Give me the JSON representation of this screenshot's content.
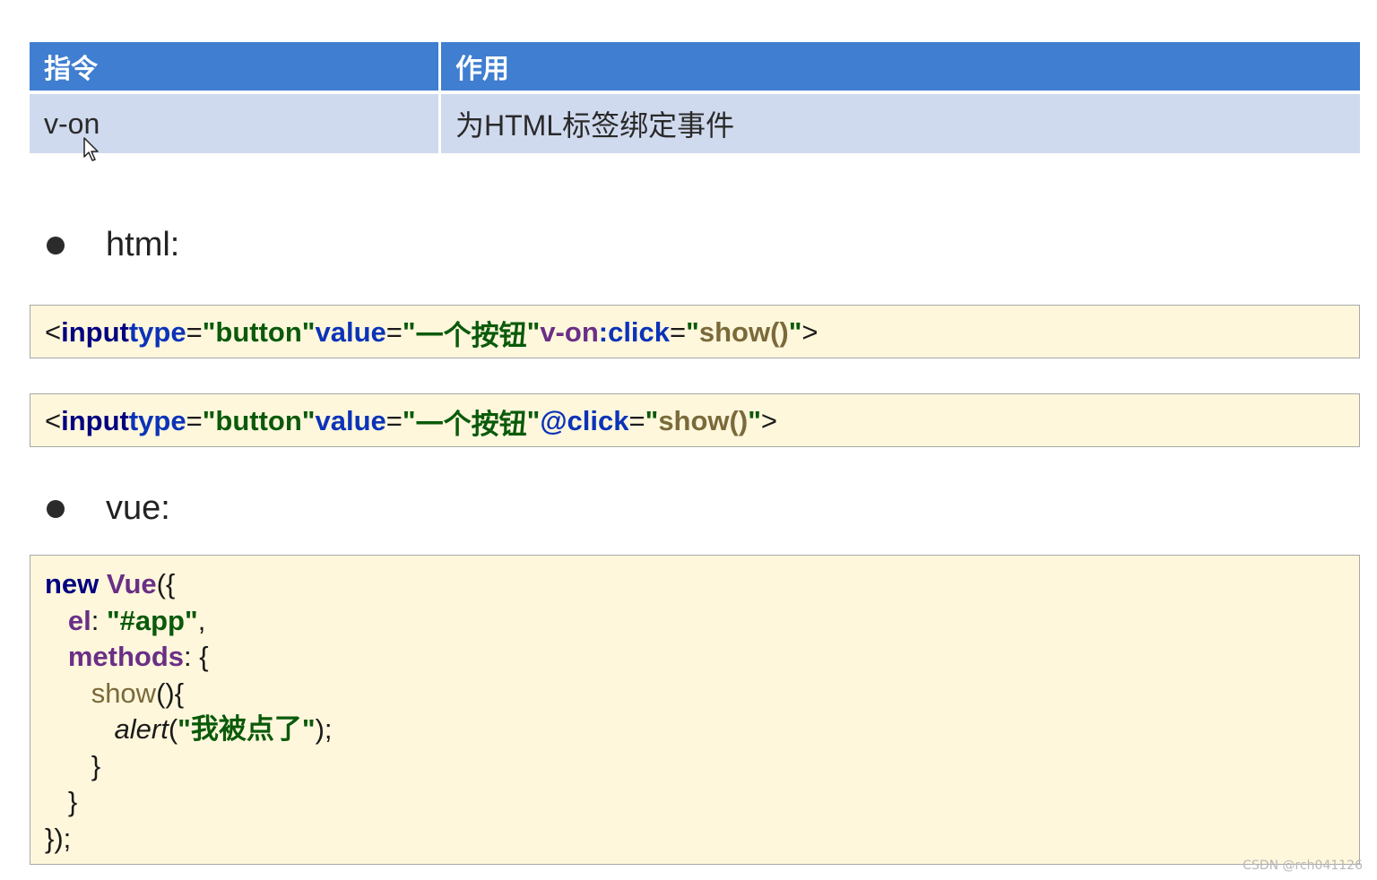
{
  "table": {
    "headers": [
      "指令",
      "作用"
    ],
    "rows": [
      [
        "v-on",
        "为HTML标签绑定事件"
      ]
    ]
  },
  "bullets": {
    "html_label": "html:",
    "vue_label": "vue:"
  },
  "html_code": {
    "line1": {
      "open": "<",
      "tag": "input",
      "type_attr": "type",
      "eq1": "=",
      "type_val": "\"button\"",
      "value_attr": "value",
      "eq2": "=",
      "q_open": "\"",
      "value_text": "一个按钮",
      "q_close": "\"",
      "directive_prefix": "v-on",
      "colon": ":",
      "event": "click",
      "eq3": "=",
      "h_q_open": "\"",
      "handler": "show()",
      "h_q_close": "\"",
      "close": ">"
    },
    "line2": {
      "open": "<",
      "tag": "input",
      "type_attr": "type",
      "eq1": "=",
      "type_val": "\"button\"",
      "value_attr": "value",
      "eq2": "=",
      "q_open": "\"",
      "value_text": "一个按钮",
      "q_close": "\"",
      "shorthand": "@click",
      "eq3": "=",
      "h_q_open": "\"",
      "handler": "show()",
      "h_q_close": "\"",
      "close": ">"
    }
  },
  "vue_code": {
    "l1_kw": "new",
    "l1_cls": "Vue",
    "l1_rest": "({",
    "l2_indent": "   ",
    "l2_prop": "el",
    "l2_colon": ": ",
    "l2_val": "\"#app\"",
    "l2_comma": ",",
    "l3_indent": "   ",
    "l3_prop": "methods",
    "l3_rest": ": {",
    "l4_indent": "      ",
    "l4_method": "show",
    "l4_rest": "(){",
    "l5_indent": "         ",
    "l5_fn": "alert",
    "l5_paren_open": "(",
    "l5_q_open": "\"",
    "l5_text": "我被点了",
    "l5_q_close": "\"",
    "l5_end": ");",
    "l6_indent": "      ",
    "l6_text": "}",
    "l7_indent": "   ",
    "l7_text": "}",
    "l8_text": "});"
  },
  "watermark": "CSDN @rch041126"
}
